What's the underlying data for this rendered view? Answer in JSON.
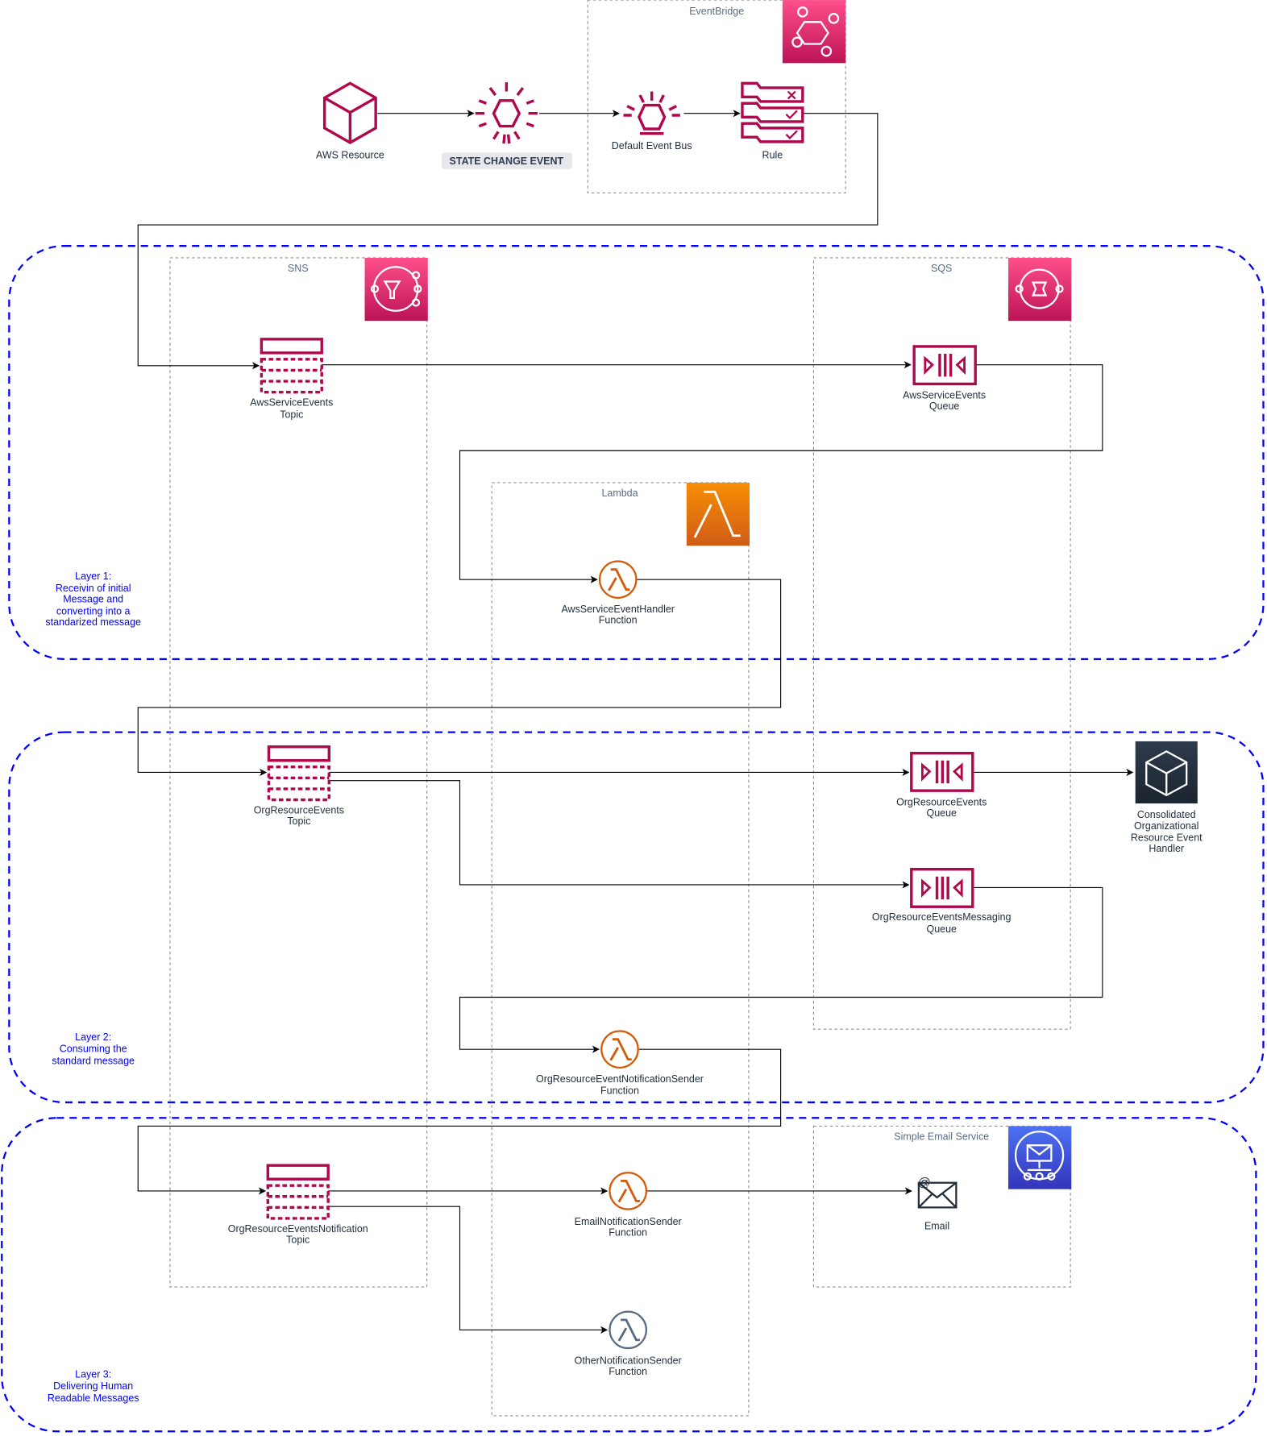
{
  "groups": {
    "eventbridge": "EventBridge",
    "sns": "SNS",
    "sqs": "SQS",
    "lambda": "Lambda",
    "ses": "Simple Email Service"
  },
  "nodes": {
    "aws_resource": "AWS Resource",
    "state_change_event": "STATE CHANGE EVENT",
    "default_event_bus": "Default Event Bus",
    "rule": "Rule",
    "aws_service_events_topic": [
      "AwsServiceEvents",
      "Topic"
    ],
    "aws_service_events_queue": [
      "AwsServiceEvents",
      "Queue"
    ],
    "aws_service_event_handler": [
      "AwsServiceEventHandler",
      "Function"
    ],
    "org_resource_events_topic": [
      "OrgResourceEvents",
      "Topic"
    ],
    "org_resource_events_queue": [
      "OrgResourceEvents",
      "Queue"
    ],
    "consolidated_handler": [
      "Consolidated",
      "Organizational",
      "Resource Event",
      "Handler"
    ],
    "org_resource_events_messaging_queue": [
      "OrgResourceEventsMessaging",
      "Queue"
    ],
    "org_resource_event_notification_sender": [
      "OrgResourceEventNotificationSender",
      "Function"
    ],
    "org_resource_events_notification_topic": [
      "OrgResourceEventsNotification",
      "Topic"
    ],
    "email_notification_sender": [
      "EmailNotificationSender",
      "Function"
    ],
    "email": "Email",
    "other_notification_sender": [
      "OtherNotificationSender",
      "Function"
    ]
  },
  "layers": {
    "layer1": [
      "Layer 1:",
      "Receivin of initial",
      "Message and",
      "converting into a",
      "standarized message"
    ],
    "layer2": [
      "Layer 2:",
      "Consuming the",
      "standard message"
    ],
    "layer3": [
      "Layer 3:",
      "Delivering Human",
      "Readable Messages"
    ]
  },
  "colors": {
    "application_integration": "#e7157b",
    "compute": "#ed7100",
    "ses": "#3b48cc",
    "generic_dark": "#232f3e",
    "layer_border": "#0000ff",
    "resource_icon": "#b0084d"
  }
}
